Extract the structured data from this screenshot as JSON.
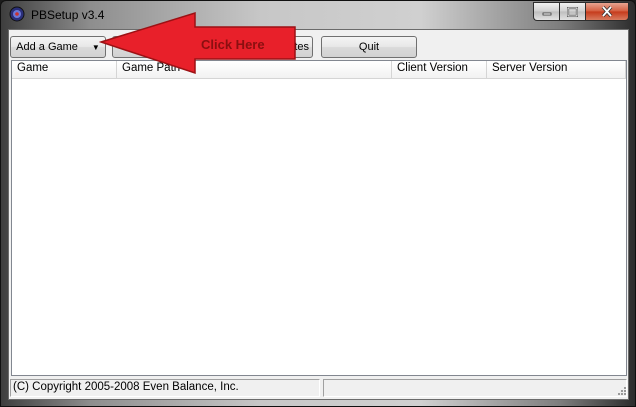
{
  "window": {
    "title": "PBSetup v3.4"
  },
  "toolbar": {
    "add_game_label": "Add a Game",
    "dropdown_glyph": "▼",
    "check_updates_label_visible": "tes",
    "quit_label": "Quit"
  },
  "listview": {
    "columns": [
      "Game",
      "Game Path",
      "Client Version",
      "Server Version"
    ]
  },
  "statusbar": {
    "copyright": "(C) Copyright 2005-2008 Even Balance, Inc.",
    "pane2": ""
  },
  "annotation": {
    "text": "Click Here",
    "color": "#e8202a"
  },
  "icons": {
    "app": "app-icon",
    "minimize": "minimize-icon",
    "maximize": "maximize-icon",
    "close": "close-icon"
  }
}
